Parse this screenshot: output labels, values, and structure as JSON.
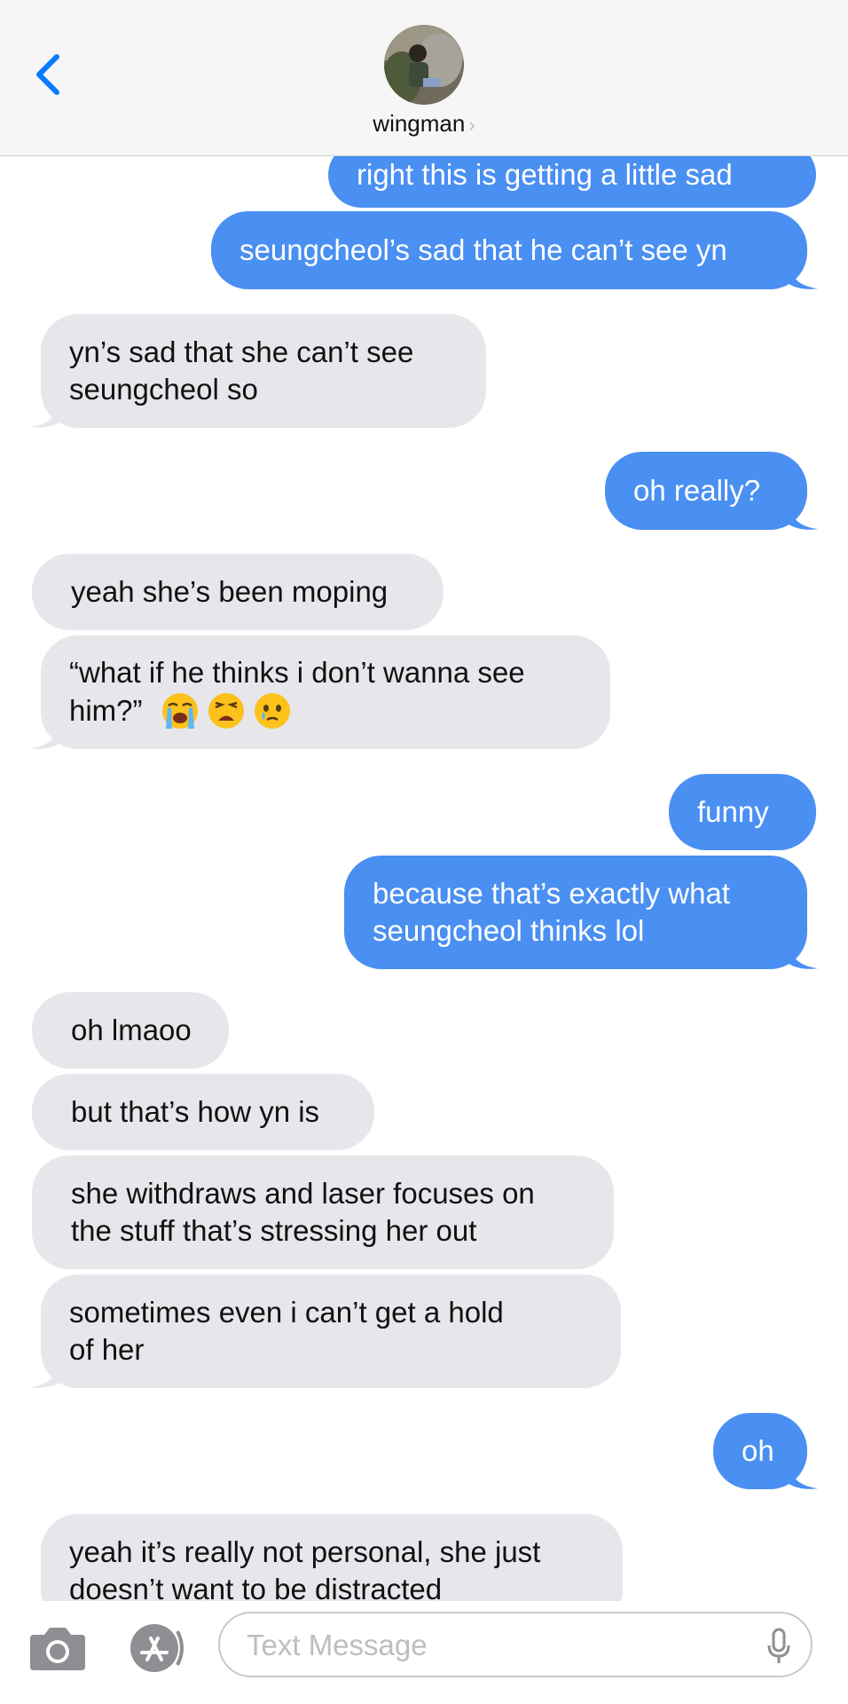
{
  "header": {
    "back_icon": "chevron-left-icon",
    "contact_name": "wingman",
    "contact_chevron": "›",
    "accent": "#0a7aff"
  },
  "messages": [
    {
      "from": "me",
      "text": "right this is getting a little sad"
    },
    {
      "from": "me",
      "text": "seungcheol’s sad that he can’t see yn"
    },
    {
      "from": "them",
      "text_lines": [
        "yn’s sad that she can’t see",
        "seungcheol so"
      ]
    },
    {
      "from": "me",
      "text": "oh really?"
    },
    {
      "from": "them",
      "text": "yeah she’s been moping"
    },
    {
      "from": "them",
      "text_lines": [
        "“what if he thinks i don’t wanna see",
        "him?”"
      ],
      "emojis": [
        "loudly-crying-face",
        "weary-face",
        "face-holding-back-tears"
      ]
    },
    {
      "from": "me",
      "text": "funny"
    },
    {
      "from": "me",
      "text_lines": [
        "because that’s exactly what",
        "seungcheol thinks lol"
      ]
    },
    {
      "from": "them",
      "text": "oh lmaoo"
    },
    {
      "from": "them",
      "text": "but that’s how yn is"
    },
    {
      "from": "them",
      "text_lines": [
        "she withdraws and laser focuses on",
        "the stuff that’s stressing her out"
      ]
    },
    {
      "from": "them",
      "text_lines": [
        "sometimes even i can’t get a hold",
        "of her"
      ]
    },
    {
      "from": "me",
      "text": "oh"
    },
    {
      "from": "them",
      "text_lines": [
        "yeah it’s really not personal, she just",
        "doesn’t want to be distracted"
      ]
    }
  ],
  "compose": {
    "placeholder": "Text Message",
    "camera_icon": "camera-icon",
    "apps_icon": "app-store-icon",
    "mic_icon": "microphone-icon"
  },
  "colors": {
    "sent_bubble": "#4a8ff2",
    "received_bubble": "#e6e6eb",
    "header_bg": "#f6f6f6"
  }
}
